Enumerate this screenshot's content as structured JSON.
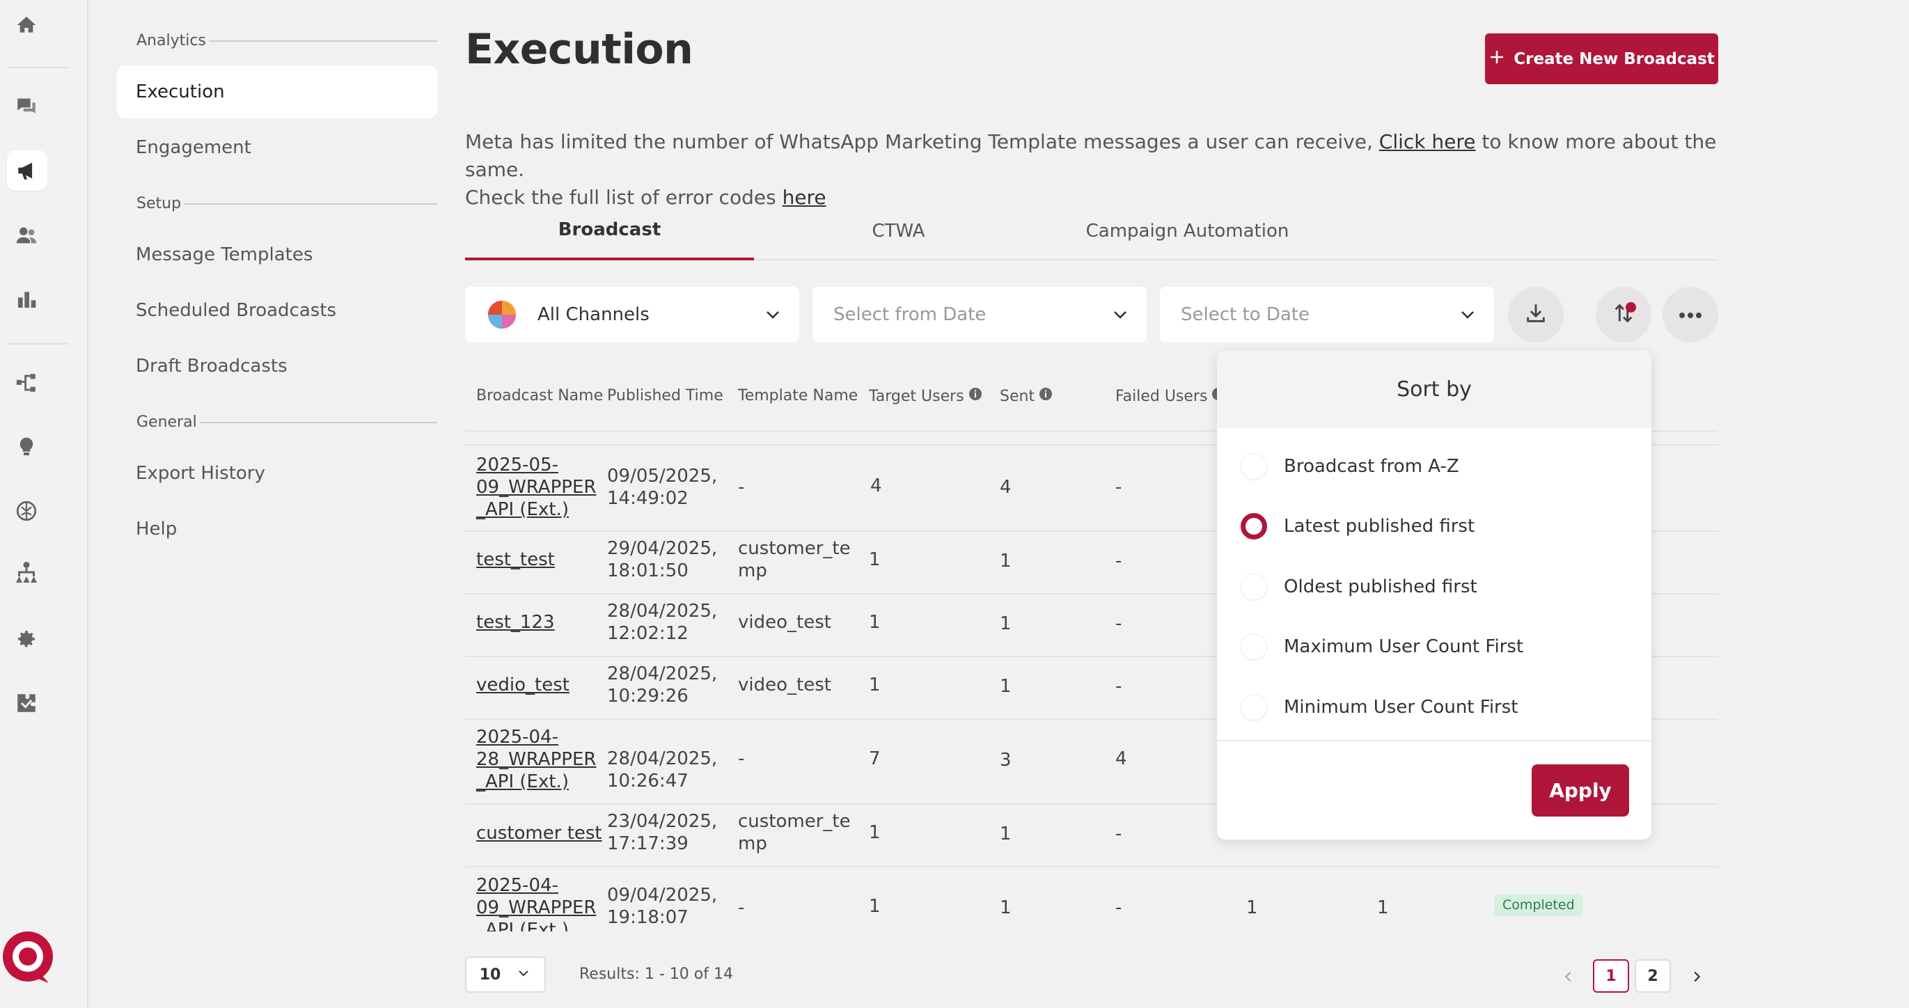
{
  "nav": {
    "analytics_label": "Analytics",
    "setup_label": "Setup",
    "general_label": "General",
    "items": [
      {
        "label": "Execution"
      },
      {
        "label": "Engagement"
      },
      {
        "label": "Message Templates"
      },
      {
        "label": "Scheduled Broadcasts"
      },
      {
        "label": "Draft Broadcasts"
      },
      {
        "label": "Export History"
      },
      {
        "label": "Help"
      }
    ]
  },
  "header": {
    "title": "Execution",
    "create_label": "Create New Broadcast"
  },
  "notice": {
    "line1_text": "Meta has limited the number of WhatsApp Marketing Template messages a user can receive, ",
    "line1_link": "Click here",
    "line1_tail": " to know more about the same.",
    "line2_text": "Check the full list of error codes ",
    "line2_link": "here"
  },
  "tabs": [
    {
      "label": "Broadcast"
    },
    {
      "label": "CTWA"
    },
    {
      "label": "Campaign Automation"
    }
  ],
  "filters": {
    "channel": "All Channels",
    "from_placeholder": "Select from Date",
    "to_placeholder": "Select to Date"
  },
  "table": {
    "columns": [
      "Broadcast Name",
      "Published Time",
      "Template Name",
      "Target Users",
      "Sent",
      "Failed Users"
    ],
    "rows": [
      {
        "name": [
          "2025-05-",
          "09_WRAPPER",
          "_API (Ext.)"
        ],
        "time": [
          "09/05/2025,",
          "14:49:02"
        ],
        "template": [
          "-"
        ],
        "target": "4",
        "sent": "4",
        "failed": "-"
      },
      {
        "name": [
          "test_test"
        ],
        "time": [
          "29/04/2025,",
          "18:01:50"
        ],
        "template": [
          "customer_te",
          "mp"
        ],
        "target": "1",
        "sent": "1",
        "failed": "-"
      },
      {
        "name": [
          "test_123"
        ],
        "time": [
          "28/04/2025,",
          "12:02:12"
        ],
        "template": [
          "video_test"
        ],
        "target": "1",
        "sent": "1",
        "failed": "-"
      },
      {
        "name": [
          "vedio_test"
        ],
        "time": [
          "28/04/2025,",
          "10:29:26"
        ],
        "template": [
          "video_test"
        ],
        "target": "1",
        "sent": "1",
        "failed": "-"
      },
      {
        "name": [
          "2025-04-",
          "28_WRAPPER",
          "_API (Ext.)"
        ],
        "time": [
          "28/04/2025,",
          "10:26:47"
        ],
        "template": [
          "-"
        ],
        "target": "7",
        "sent": "3",
        "failed": "4"
      },
      {
        "name": [
          "customer test"
        ],
        "time": [
          "23/04/2025,",
          "17:17:39"
        ],
        "template": [
          "customer_te",
          "mp"
        ],
        "target": "1",
        "sent": "1",
        "failed": "-"
      },
      {
        "name": [
          "2025-04-",
          "09_WRAPPER",
          "_API (Ext.)"
        ],
        "time": [
          "09/04/2025,",
          "19:18:07"
        ],
        "template": [
          "-"
        ],
        "target": "1",
        "sent": "1",
        "failed": "-",
        "col7": "1",
        "col8": "1",
        "status": "Completed"
      }
    ]
  },
  "sort_popup": {
    "title": "Sort by",
    "options": [
      {
        "label": "Broadcast from A-Z",
        "selected": false
      },
      {
        "label": "Latest published first",
        "selected": true
      },
      {
        "label": "Oldest published first",
        "selected": false
      },
      {
        "label": "Maximum User Count First",
        "selected": false
      },
      {
        "label": "Minimum User Count First",
        "selected": false
      }
    ],
    "apply_label": "Apply"
  },
  "footer": {
    "page_size": "10",
    "results": "Results: 1 - 10 of 14",
    "pages": [
      "1",
      "2"
    ],
    "current_page": "1"
  },
  "colors": {
    "accent": "#b01639",
    "status_bg": "#d7efdf"
  },
  "icons": [
    "home-icon",
    "chat-icon",
    "megaphone-icon",
    "users-icon",
    "bar-chart-icon",
    "flow-icon",
    "bulb-icon",
    "brain-icon",
    "hierarchy-icon",
    "gear-icon",
    "puzzle-icon"
  ]
}
